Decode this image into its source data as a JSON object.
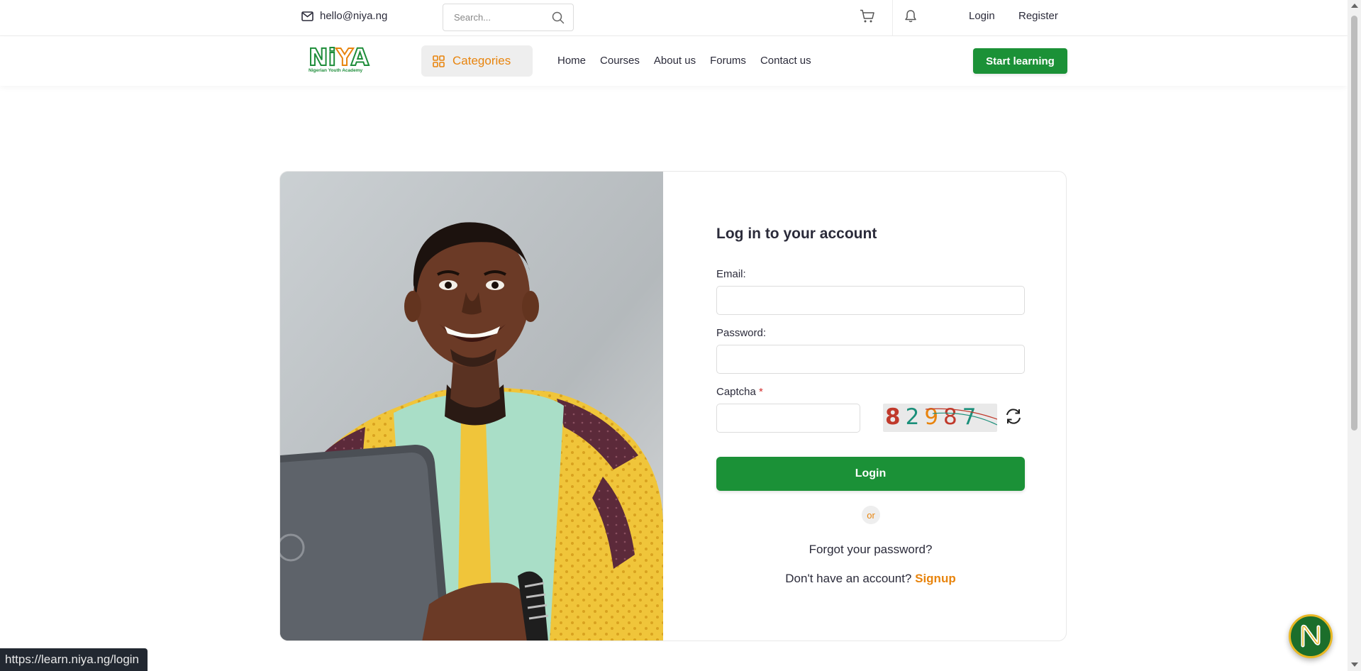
{
  "topbar": {
    "email": "hello@niya.ng",
    "search_placeholder": "Search...",
    "login": "Login",
    "register": "Register"
  },
  "navbar": {
    "logo_text": "NiYA",
    "logo_subtitle": "Nigerian Youth Academy",
    "categories": "Categories",
    "links": [
      "Home",
      "Courses",
      "About us",
      "Forums",
      "Contact us"
    ],
    "cta": "Start learning"
  },
  "login_form": {
    "title": "Log in to your account",
    "email_label": "Email:",
    "password_label": "Password:",
    "captcha_label": "Captcha",
    "captcha_required_mark": "*",
    "captcha_digits": [
      "8",
      "2",
      "9",
      "8",
      "7"
    ],
    "captcha_colors": [
      "#c0392b",
      "#1a8f7a",
      "#e8840d",
      "#c0392b",
      "#1a8f7a"
    ],
    "submit": "Login",
    "or": "or",
    "forgot": "Forgot your password?",
    "no_account": "Don't have an account?",
    "signup": "Signup"
  },
  "status_bar": {
    "url": "https://learn.niya.ng/login"
  },
  "colors": {
    "brand_green": "#1b9137",
    "accent_orange": "#e8840d",
    "text_dark": "#2b2b3a"
  }
}
